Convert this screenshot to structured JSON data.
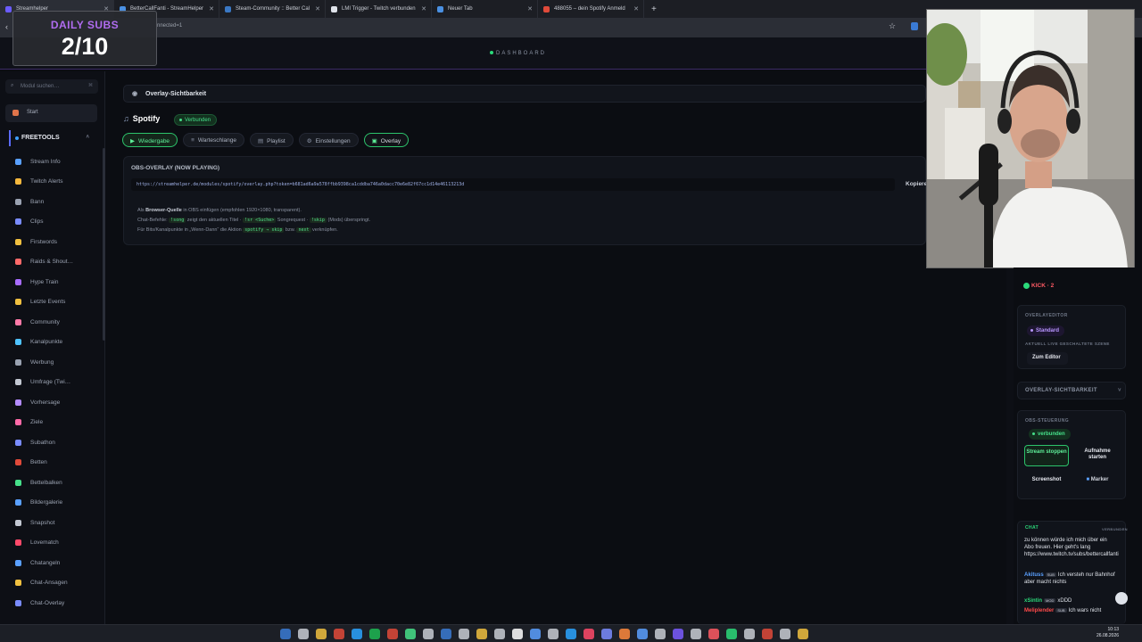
{
  "browser": {
    "tabs": [
      {
        "label": "Streamhelper",
        "color": "#6b5cff"
      },
      {
        "label": "BetterCallFanti - StreamHelper",
        "color": "#4a90e2"
      },
      {
        "label": "Steam-Community :: Better Cal",
        "color": "#3a78c4"
      },
      {
        "label": "LMI Trigger - Twitch verbunden",
        "color": "#dfe3ea"
      },
      {
        "label": "Neuer Tab",
        "color": "#4a90e2"
      },
      {
        "label": "488055 – dein Spotify Anmeld",
        "color": "#e04a3a"
      }
    ],
    "url_fragment": "nnected=1"
  },
  "subs_widget": {
    "label": "DAILY SUBS",
    "count": "2/10"
  },
  "header": {
    "title": "DASHBOARD"
  },
  "sidebar": {
    "search_placeholder": "Modul suchen…",
    "start_label": "Start",
    "section_label": "FREETOOLS",
    "items": [
      {
        "label": "Stream Info",
        "color": "#5aa0ff"
      },
      {
        "label": "Twitch Alerts",
        "color": "#f5b83d"
      },
      {
        "label": "Bann",
        "color": "#9aa2b1"
      },
      {
        "label": "Clips",
        "color": "#7a8cff"
      },
      {
        "label": "Firstwords",
        "color": "#f0c040"
      },
      {
        "label": "Raids & Shout…",
        "color": "#ff6a6a"
      },
      {
        "label": "Hype Train",
        "color": "#a86cff"
      },
      {
        "label": "Letzte Events",
        "color": "#f0c040"
      },
      {
        "label": "Community",
        "color": "#ff7aa8"
      },
      {
        "label": "Kanalpunkte",
        "color": "#4fc3ff"
      },
      {
        "label": "Werbung",
        "color": "#9aa2b1"
      },
      {
        "label": "Umfrage (Twi…",
        "color": "#c3c8d2"
      },
      {
        "label": "Vorhersage",
        "color": "#b48cff"
      },
      {
        "label": "Ziele",
        "color": "#ff6aa8"
      },
      {
        "label": "Subathon",
        "color": "#7a8cff"
      },
      {
        "label": "Betten",
        "color": "#e04a3a"
      },
      {
        "label": "Bettelbalken",
        "color": "#46e08a"
      },
      {
        "label": "Bildergalerie",
        "color": "#5aa0ff"
      },
      {
        "label": "Snapshot",
        "color": "#c3c8d2"
      },
      {
        "label": "Lovematch",
        "color": "#ff4a6a"
      },
      {
        "label": "Chatangeln",
        "color": "#5aa0ff"
      },
      {
        "label": "Chat-Ansagen",
        "color": "#f0c040"
      },
      {
        "label": "Chat-Overlay",
        "color": "#7a8cff"
      }
    ]
  },
  "main": {
    "overlay_card_title": "Overlay-Sichtbarkeit",
    "service_title": "Spotify",
    "status_badge": "Verbunden",
    "tabs": [
      {
        "label": "Wiedergabe",
        "icon": "▶"
      },
      {
        "label": "Warteschlange",
        "icon": "≡"
      },
      {
        "label": "Playlist",
        "icon": "▤"
      },
      {
        "label": "Einstellungen",
        "icon": "⚙"
      },
      {
        "label": "Overlay",
        "icon": "▣"
      }
    ],
    "panel_title": "OBS-OVERLAY (NOW PLAYING)",
    "overlay_url": "https://streamhelper.de/modules/spotify/overlay.php?token=b681ad6a9a578ffbb9398ca1cddba746a0dacc70e6e82f67cc1d14e46113213d",
    "copy_label": "Kopieren",
    "info": {
      "line1_pre": "Als",
      "line1_bold": "Browser-Quelle",
      "line1_post": "in OBS einfügen (empfohlen 1920×1080, transparent).",
      "line2_pre": "Chat-Befehle:",
      "cmd_song": "!song",
      "line2_mid1": "zeigt den aktuellen Titel ·",
      "cmd_sr": "!sr <Suche>",
      "line2_mid2": "Songrequest ·",
      "cmd_skip": "!skip",
      "line2_post": "(Mods) überspringt.",
      "line3_pre": "Für Bits/Kanalpunkte in „Wenn-Dann“ die Aktion",
      "cmd_action": "spotify → skip",
      "line3_mid": "bzw.",
      "cmd_next": "next",
      "line3_post": "verknüpfen."
    }
  },
  "right_panel": {
    "kick_label": "KICK · 2",
    "overlayeditor_label": "OVERLAYEDITOR",
    "scene_pill": "Standard",
    "scene_caption": "AKTUELL LIVE GESCHALTETE SZENE",
    "editor_button": "Zum Editor",
    "overlay_visibility": "OVERLAY-SICHTBARKEIT",
    "obs_label": "OBS-STEUERUNG",
    "obs_status": "verbunden",
    "btn_stream": "Stream stoppen",
    "btn_record": "Aufnahme starten",
    "btn_screenshot": "Screenshot",
    "btn_marker": "Marker",
    "chat_label": "CHAT",
    "chat_status": "VERBUNDEN",
    "chat_msg1": "zu können würde ich mich über ein Abo freuen. Hier geht's lang https://www.twitch.tv/subs/bettercallfanti",
    "chat_user2": "Akituss",
    "chat_tag2": "SUB",
    "chat_msg2": "Ich versteh nur Bahnhof aber macht nichts",
    "chat_user3": "xSintin",
    "chat_tag3": "MOD",
    "chat_msg3": "xDDD",
    "chat_user4": "Meliplender",
    "chat_tag4": "SUB",
    "chat_msg4": "Ich wars nicht"
  },
  "taskbar": {
    "time": "10:13",
    "date": "26.08.2026",
    "icons": [
      "#3a7bd5",
      "#c8ccd4",
      "#f0c040",
      "#e04a3a",
      "#2aa5ff",
      "#1db954",
      "#e04a3a",
      "#46e08a",
      "#c8ccd4",
      "#3a7bd5",
      "#c8ccd4",
      "#f0c040",
      "#c8ccd4",
      "#ffffff",
      "#5aa0ff",
      "#c8ccd4",
      "#2aa5ff",
      "#ff4a6a",
      "#7a8cff",
      "#ff8a3d",
      "#5aa0ff",
      "#c8ccd4",
      "#7a5cff",
      "#c8ccd4",
      "#ff5a64",
      "#2bd97a",
      "#c8ccd4",
      "#e04a3a",
      "#c8ccd4",
      "#f0c040"
    ]
  }
}
